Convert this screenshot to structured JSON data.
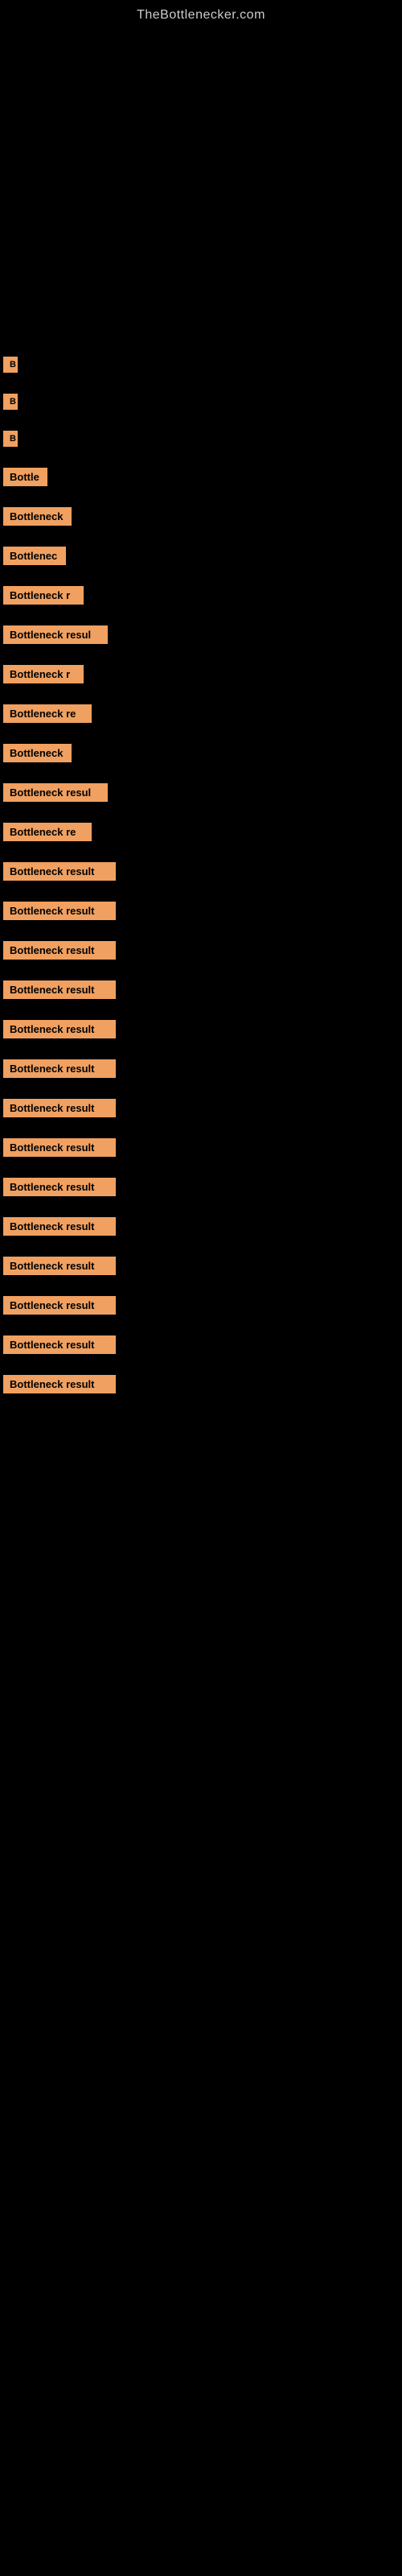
{
  "site": {
    "title": "TheBottlenecker.com"
  },
  "items": [
    {
      "id": 1,
      "label": "Bottle",
      "width": 55
    },
    {
      "id": 2,
      "label": "Bottleneck",
      "width": 85
    },
    {
      "id": 3,
      "label": "Bottlenec",
      "width": 78
    },
    {
      "id": 4,
      "label": "Bottleneck r",
      "width": 100
    },
    {
      "id": 5,
      "label": "Bottleneck resul",
      "width": 130
    },
    {
      "id": 6,
      "label": "Bottleneck r",
      "width": 100
    },
    {
      "id": 7,
      "label": "Bottleneck re",
      "width": 108
    },
    {
      "id": 8,
      "label": "Bottleneck",
      "width": 85
    },
    {
      "id": 9,
      "label": "Bottleneck resul",
      "width": 130
    },
    {
      "id": 10,
      "label": "Bottleneck re",
      "width": 108
    },
    {
      "id": 11,
      "label": "Bottleneck result",
      "width": 140
    },
    {
      "id": 12,
      "label": "Bottleneck result",
      "width": 140
    },
    {
      "id": 13,
      "label": "Bottleneck result",
      "width": 140
    },
    {
      "id": 14,
      "label": "Bottleneck result",
      "width": 140
    },
    {
      "id": 15,
      "label": "Bottleneck result",
      "width": 140
    },
    {
      "id": 16,
      "label": "Bottleneck result",
      "width": 140
    },
    {
      "id": 17,
      "label": "Bottleneck result",
      "width": 140
    },
    {
      "id": 18,
      "label": "Bottleneck result",
      "width": 140
    },
    {
      "id": 19,
      "label": "Bottleneck result",
      "width": 140
    },
    {
      "id": 20,
      "label": "Bottleneck result",
      "width": 140
    },
    {
      "id": 21,
      "label": "Bottleneck result",
      "width": 140
    },
    {
      "id": 22,
      "label": "Bottleneck result",
      "width": 140
    },
    {
      "id": 23,
      "label": "Bottleneck result",
      "width": 140
    },
    {
      "id": 24,
      "label": "Bottleneck result",
      "width": 140
    }
  ],
  "small_labels": [
    {
      "id": 1,
      "label": "B",
      "width": 18
    },
    {
      "id": 2,
      "label": "B",
      "width": 18
    },
    {
      "id": 3,
      "label": "B",
      "width": 18
    }
  ]
}
